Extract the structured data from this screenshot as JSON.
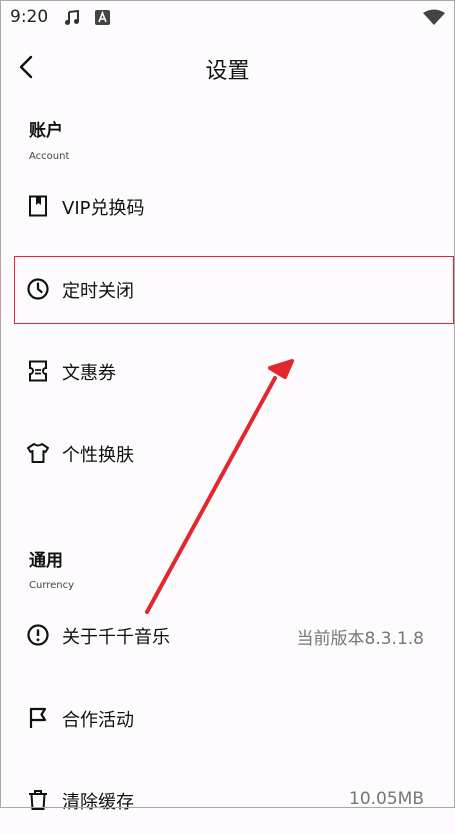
{
  "status_bar": {
    "time": "9:20",
    "icons": [
      "music-note-icon",
      "font-a-icon",
      "wifi-icon"
    ]
  },
  "header": {
    "title": "设置",
    "back_icon": "back-arrow-icon"
  },
  "sections": [
    {
      "title": "账户",
      "subtitle": "Account",
      "items": [
        {
          "label": "VIP兑换码",
          "icon": "bookmark-icon"
        },
        {
          "label": "定时关闭",
          "icon": "clock-icon"
        },
        {
          "label": "文惠券",
          "icon": "coupon-icon"
        },
        {
          "label": "个性换肤",
          "icon": "shirt-icon"
        }
      ]
    },
    {
      "title": "通用",
      "subtitle": "Currency",
      "items": [
        {
          "label": "关于千千音乐",
          "icon": "info-icon",
          "value": "当前版本8.3.1.8"
        },
        {
          "label": "合作活动",
          "icon": "flag-icon"
        },
        {
          "label": "清除缓存",
          "icon": "trash-icon",
          "value": "10.05MB"
        }
      ]
    }
  ],
  "colors": {
    "highlight": "#e0282e",
    "background": "#fdfbfd"
  }
}
